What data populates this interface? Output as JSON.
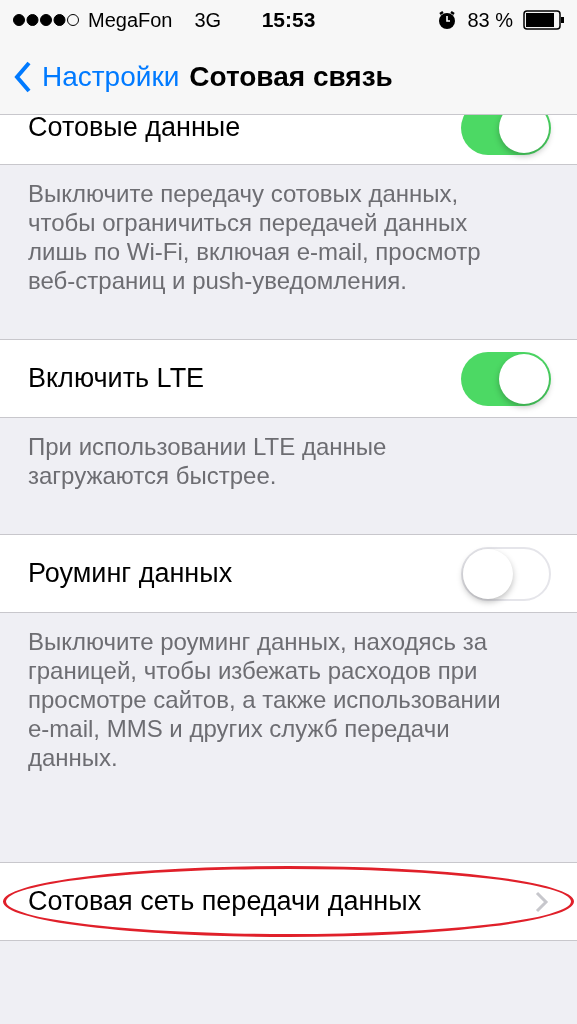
{
  "status_bar": {
    "carrier": "MegaFon",
    "network": "3G",
    "time": "15:53",
    "battery": "83 %"
  },
  "nav": {
    "back": "Настройки",
    "title": "Сотовая связь"
  },
  "sections": [
    {
      "kind": "toggle",
      "label": "Сотовые данные",
      "on": true,
      "footer": "Выключите передачу сотовых данных, чтобы ограничиться передачей данных лишь по Wi-Fi, включая e-mail, просмотр веб-страниц и push-уведомления."
    },
    {
      "kind": "toggle",
      "label": "Включить LTE",
      "on": true,
      "footer": "При использовании LTE данные загружаются быстрее."
    },
    {
      "kind": "toggle",
      "label": "Роуминг данных",
      "on": false,
      "footer": "Выключите роуминг данных, находясь за границей, чтобы избежать расходов при просмотре сайтов, а также использовании e-mail, MMS и других служб передачи данных."
    },
    {
      "kind": "link",
      "label": "Сотовая сеть передачи данных",
      "highlighted": true
    }
  ]
}
